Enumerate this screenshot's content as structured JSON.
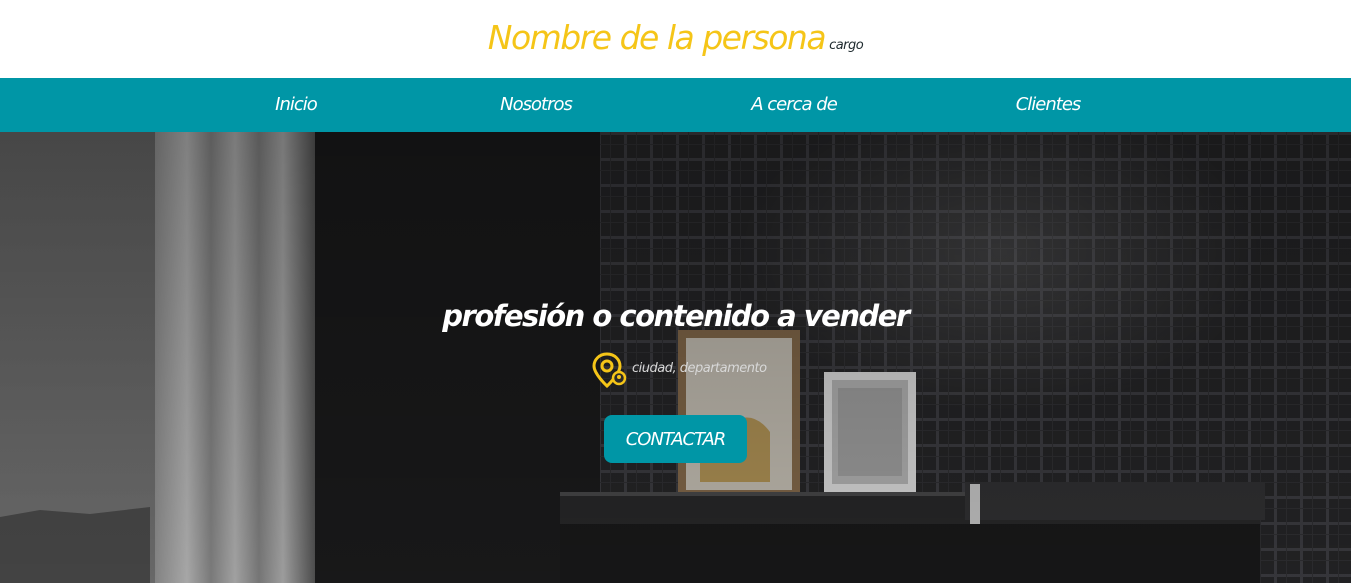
{
  "header": {
    "name": "Nombre de la persona",
    "role": "cargo"
  },
  "nav": {
    "items": [
      {
        "label": "Inicio"
      },
      {
        "label": "Nosotros"
      },
      {
        "label": "A cerca de"
      },
      {
        "label": "Clientes"
      }
    ]
  },
  "hero": {
    "title": "profesión o contenido a vender",
    "location": "ciudad, departamento",
    "location_icon": "map-pin-icon",
    "cta_label": "CONTACTAR",
    "background_image": "room-with-shelf-and-framed-pictures"
  },
  "colors": {
    "brand_yellow": "#f5c518",
    "accent_teal": "#0096a6",
    "header_bg": "#ffffff"
  }
}
